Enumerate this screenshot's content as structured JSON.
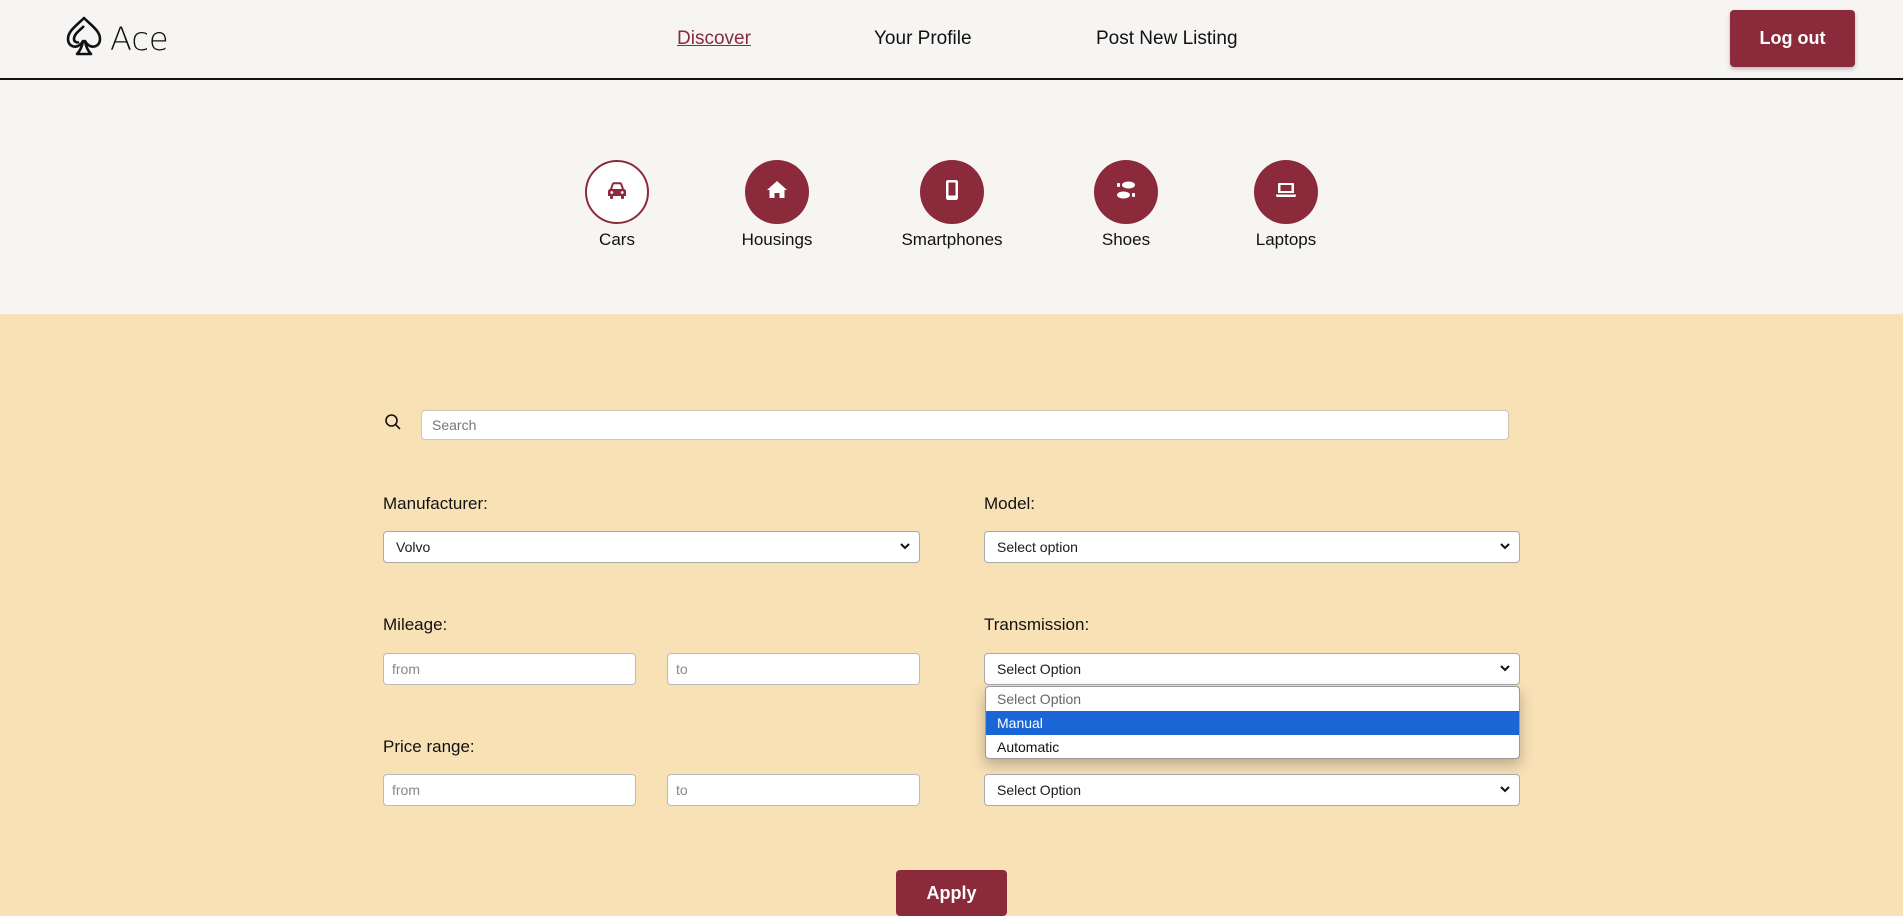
{
  "app": {
    "name": "Ace"
  },
  "nav": {
    "items": [
      {
        "label": "Discover",
        "active": true
      },
      {
        "label": "Your Profile",
        "active": false
      },
      {
        "label": "Post New Listing",
        "active": false
      }
    ],
    "logout_label": "Log out"
  },
  "categories": [
    {
      "label": "Cars",
      "icon": "car-icon",
      "selected": true
    },
    {
      "label": "Housings",
      "icon": "house-icon",
      "selected": false
    },
    {
      "label": "Smartphones",
      "icon": "smartphone-icon",
      "selected": false
    },
    {
      "label": "Shoes",
      "icon": "shoes-icon",
      "selected": false
    },
    {
      "label": "Laptops",
      "icon": "laptop-icon",
      "selected": false
    }
  ],
  "search": {
    "placeholder": "Search",
    "value": ""
  },
  "filters": {
    "manufacturer": {
      "label": "Manufacturer:",
      "value": "Volvo"
    },
    "model": {
      "label": "Model:",
      "value": "Select option"
    },
    "mileage": {
      "label": "Mileage:",
      "from_placeholder": "from",
      "to_placeholder": "to"
    },
    "transmission": {
      "label": "Transmission:",
      "value": "Select Option",
      "options": [
        "Select Option",
        "Manual",
        "Automatic"
      ],
      "highlighted": "Manual"
    },
    "price": {
      "label": "Price range:",
      "from_placeholder": "from",
      "to_placeholder": "to"
    },
    "extra_select": {
      "value": "Select Option"
    }
  },
  "apply_label": "Apply",
  "colors": {
    "accent": "#8a2a3b",
    "panel_bg": "#f9e1b6",
    "page_bg": "#f7f5f2",
    "highlight": "#1a66d6"
  }
}
